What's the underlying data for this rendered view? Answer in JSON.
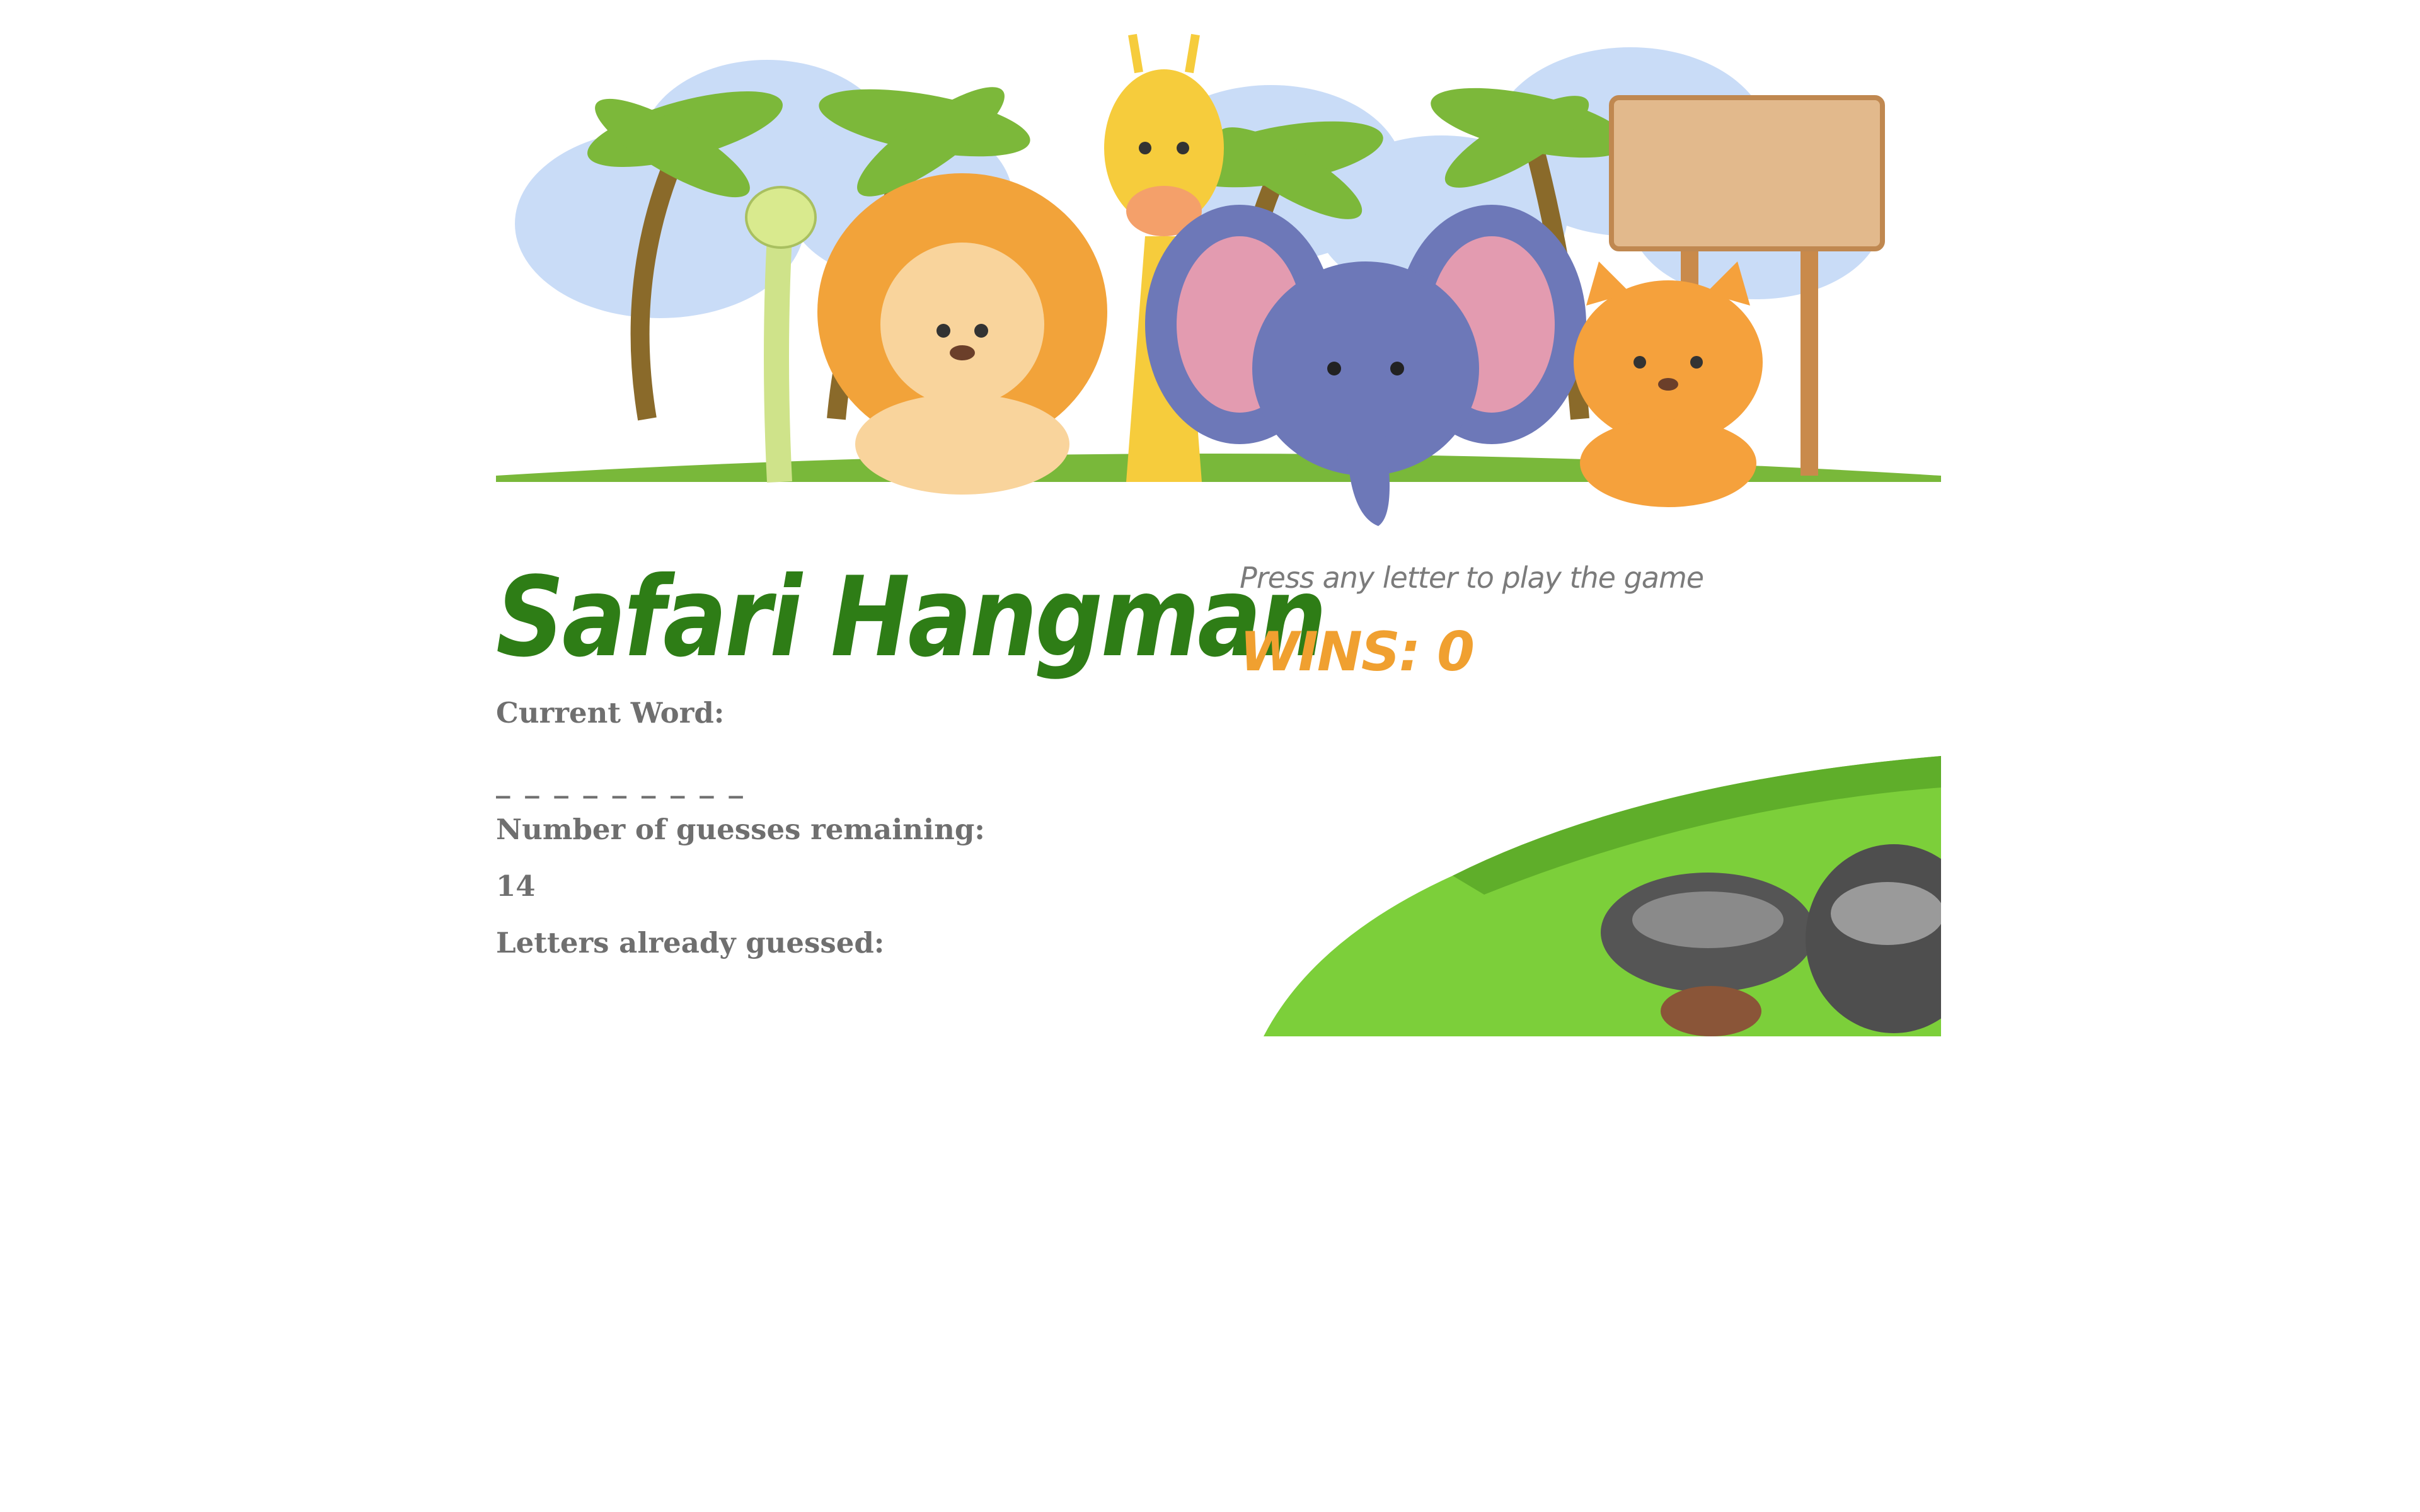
{
  "game": {
    "title": "Safari Hangman",
    "prompt": "Press any letter to play the game",
    "wins_label": "WINS:",
    "wins_value": "0",
    "current_word_label": "Current Word:",
    "current_word_value": "_ _ _ _ _ _ _ _ _",
    "guesses_label": "Number of guesses remaining:",
    "guesses_value": "14",
    "letters_label": "Letters already guessed:",
    "letters_value": ""
  },
  "colors": {
    "title": "#2e7d16",
    "wins": "#f0a030",
    "label": "#6f6f6f",
    "prompt": "#7b7b7b"
  }
}
